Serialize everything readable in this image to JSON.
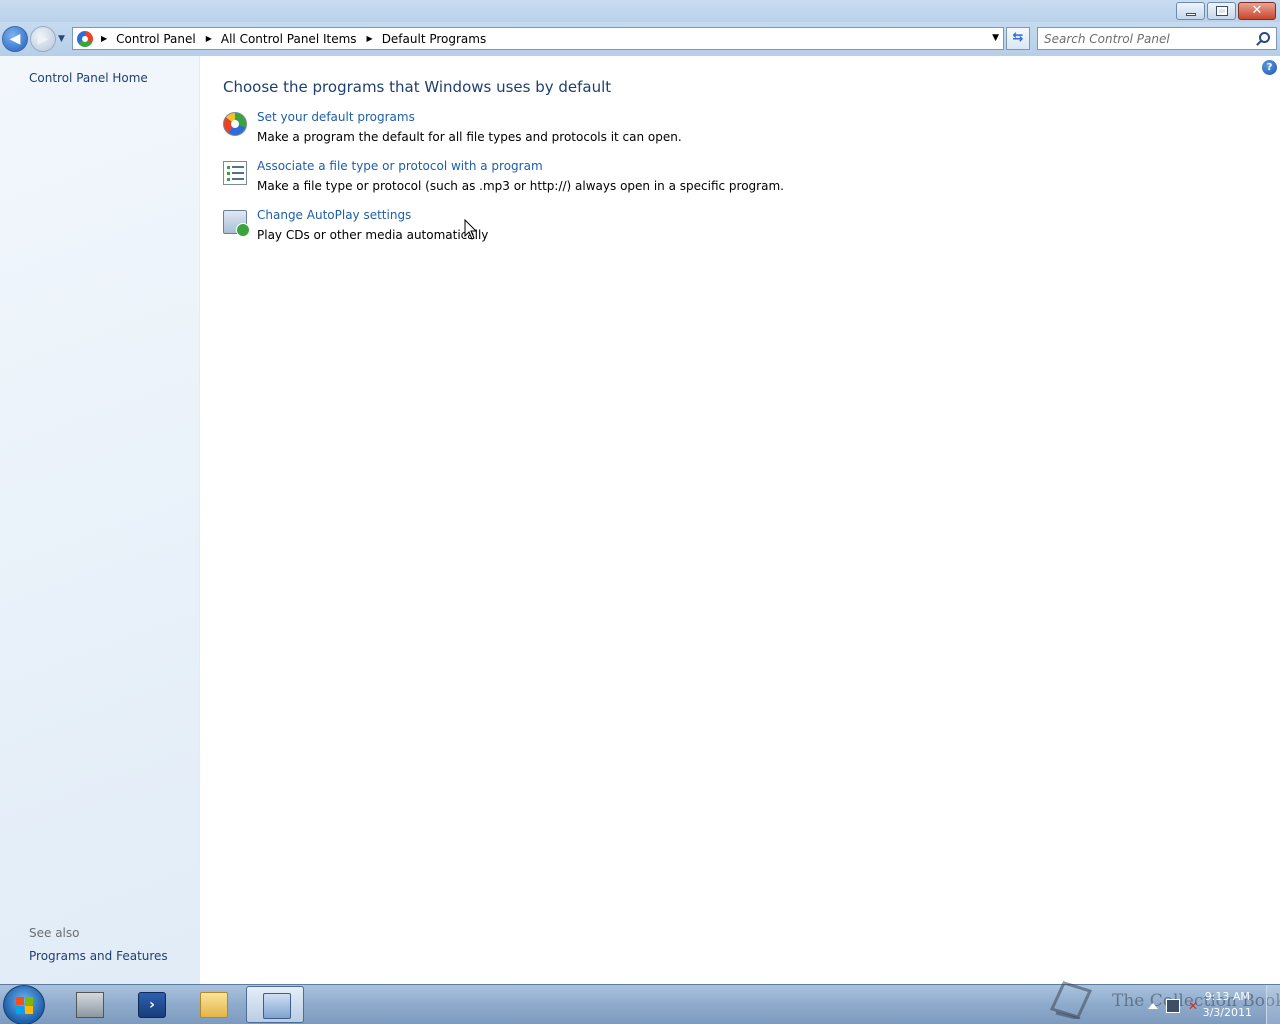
{
  "window": {
    "minimize_glyph": "minimize",
    "maximize_glyph": "restore",
    "close_glyph": "✕"
  },
  "address_bar": {
    "crumbs": [
      "Control Panel",
      "All Control Panel Items",
      "Default Programs"
    ]
  },
  "search": {
    "placeholder": "Search Control Panel"
  },
  "left_pane": {
    "home_link": "Control Panel Home",
    "see_also_label": "See also",
    "see_also_links": [
      "Programs and Features"
    ]
  },
  "main": {
    "title": "Choose the programs that Windows uses by default",
    "tasks": [
      {
        "link": "Set your default programs",
        "description": "Make a program the default for all file types and protocols it can open.",
        "icon": "default-programs-icon"
      },
      {
        "link": "Associate a file type or protocol with a program",
        "description": "Make a file type or protocol (such as .mp3 or http://) always open in a specific program.",
        "icon": "file-association-icon"
      },
      {
        "link": "Change AutoPlay settings",
        "description": "Play CDs or other media automatically",
        "icon": "autoplay-icon"
      }
    ]
  },
  "taskbar": {
    "buttons": [
      "server-manager-icon",
      "powershell-icon",
      "explorer-folder-icon",
      "control-panel-icon"
    ],
    "active_button": "control-panel-icon",
    "watermark": "The Collection Book",
    "clock_time": "9:13 AM",
    "clock_date": "3/3/2011"
  },
  "colors": {
    "link": "#1e5ea8",
    "heading": "#1e3f70",
    "left_pane": "#e8f0f8"
  }
}
